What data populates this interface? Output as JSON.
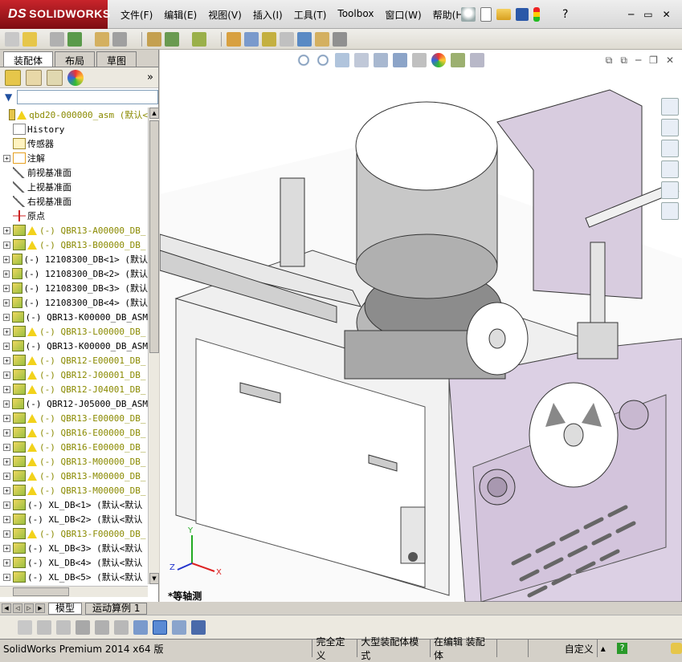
{
  "app": {
    "brand_prefix": "DS",
    "brand_name": "SOLIDWORKS"
  },
  "menu": [
    "文件(F)",
    "编辑(E)",
    "视图(V)",
    "插入(I)",
    "工具(T)",
    "Toolbox",
    "窗口(W)",
    "帮助(H)"
  ],
  "feature_manager": {
    "tabs": [
      "装配体",
      "布局",
      "草图"
    ],
    "active_tab": "装配体",
    "collapse_glyph": "»",
    "tree": [
      {
        "label": "qbd20-000000_asm  (默认<",
        "expand": false,
        "icon": "assembly-icon",
        "warn": true,
        "root": true
      },
      {
        "label": "History",
        "expand": false,
        "icon": "history-icon",
        "warn": false
      },
      {
        "label": "传感器",
        "expand": false,
        "icon": "sensor-icon",
        "warn": false
      },
      {
        "label": "注解",
        "expand": true,
        "icon": "annotation-icon",
        "warn": false
      },
      {
        "label": "前视基准面",
        "expand": false,
        "icon": "plane-icon",
        "warn": false
      },
      {
        "label": "上视基准面",
        "expand": false,
        "icon": "plane-icon",
        "warn": false
      },
      {
        "label": "右视基准面",
        "expand": false,
        "icon": "plane-icon",
        "warn": false
      },
      {
        "label": "原点",
        "expand": false,
        "icon": "origin-icon",
        "warn": false
      },
      {
        "label": "(-) QBR13-A00000_DB_",
        "expand": true,
        "icon": "subassembly-icon",
        "warn": true
      },
      {
        "label": "(-) QBR13-B00000_DB_",
        "expand": true,
        "icon": "subassembly-icon",
        "warn": true
      },
      {
        "label": "(-) 12108300_DB<1> (默认",
        "expand": true,
        "icon": "subassembly-icon",
        "warn": false
      },
      {
        "label": "(-) 12108300_DB<2> (默认",
        "expand": true,
        "icon": "subassembly-icon",
        "warn": false
      },
      {
        "label": "(-) 12108300_DB<3> (默认",
        "expand": true,
        "icon": "subassembly-icon",
        "warn": false
      },
      {
        "label": "(-) 12108300_DB<4> (默认",
        "expand": true,
        "icon": "subassembly-icon",
        "warn": false
      },
      {
        "label": "(-) QBR13-K00000_DB_ASM",
        "expand": true,
        "icon": "subassembly-icon",
        "warn": false
      },
      {
        "label": "(-) QBR13-L00000_DB_",
        "expand": true,
        "icon": "subassembly-icon",
        "warn": true
      },
      {
        "label": "(-) QBR13-K00000_DB_ASM",
        "expand": true,
        "icon": "subassembly-icon",
        "warn": false
      },
      {
        "label": "(-) QBR12-E00001_DB_",
        "expand": true,
        "icon": "subassembly-icon",
        "warn": true
      },
      {
        "label": "(-) QBR12-J00001_DB_",
        "expand": true,
        "icon": "subassembly-icon",
        "warn": true
      },
      {
        "label": "(-) QBR12-J04001_DB_",
        "expand": true,
        "icon": "subassembly-icon",
        "warn": true
      },
      {
        "label": "(-) QBR12-J05000_DB_ASM",
        "expand": true,
        "icon": "subassembly-icon",
        "warn": false
      },
      {
        "label": "(-) QBR13-E00000_DB_",
        "expand": true,
        "icon": "subassembly-icon",
        "warn": true
      },
      {
        "label": "(-) QBR16-E00000_DB_",
        "expand": true,
        "icon": "subassembly-icon",
        "warn": true
      },
      {
        "label": "(-) QBR16-E00000_DB_",
        "expand": true,
        "icon": "subassembly-icon",
        "warn": true
      },
      {
        "label": "(-) QBR13-M00000_DB_",
        "expand": true,
        "icon": "subassembly-icon",
        "warn": true
      },
      {
        "label": "(-) QBR13-M00000_DB_",
        "expand": true,
        "icon": "subassembly-icon",
        "warn": true
      },
      {
        "label": "(-) QBR13-M00000_DB_",
        "expand": true,
        "icon": "subassembly-icon",
        "warn": true
      },
      {
        "label": "(-) XL_DB<1> (默认<默认",
        "expand": true,
        "icon": "subassembly-icon",
        "warn": false
      },
      {
        "label": "(-) XL_DB<2> (默认<默认",
        "expand": true,
        "icon": "subassembly-icon",
        "warn": false
      },
      {
        "label": "(-) QBR13-F00000_DB_",
        "expand": true,
        "icon": "subassembly-icon",
        "warn": true
      },
      {
        "label": "(-) XL_DB<3> (默认<默认",
        "expand": true,
        "icon": "subassembly-icon",
        "warn": false
      },
      {
        "label": "(-) XL_DB<4> (默认<默认",
        "expand": true,
        "icon": "subassembly-icon",
        "warn": false
      },
      {
        "label": "(-) XL_DB<5> (默认<默认",
        "expand": true,
        "icon": "subassembly-icon",
        "warn": false
      }
    ]
  },
  "viewport": {
    "view_name": "*等轴测",
    "triad_x": "X",
    "triad_y": "Y",
    "triad_z": "Z"
  },
  "bottom_tabs": [
    "模型",
    "运动算例 1"
  ],
  "status": {
    "product": "SolidWorks Premium 2014 x64 版",
    "definition": "完全定义",
    "mode": "大型装配体模式",
    "editing": "在编辑 装配体",
    "units": "自定义"
  },
  "colors": {
    "brand_red": "#b0141c",
    "warning_yellow": "#f2d21b",
    "machine_purple": "#d9cde0",
    "metal_gray": "#bfbfbf"
  }
}
